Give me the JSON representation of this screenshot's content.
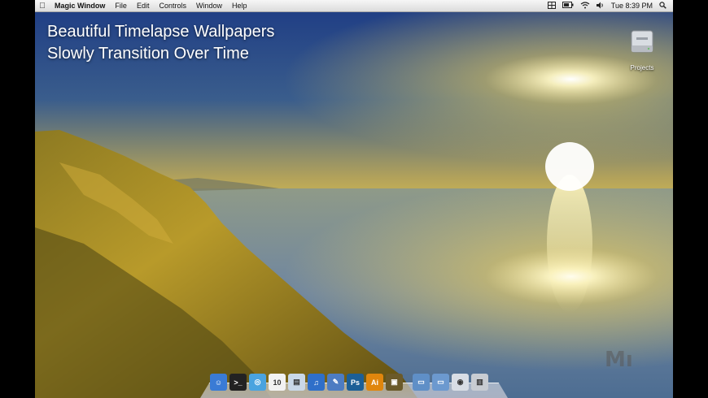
{
  "menubar": {
    "apple_icon": "apple-icon",
    "app_name": "Magic Window",
    "menus": [
      "File",
      "Edit",
      "Controls",
      "Window",
      "Help"
    ],
    "clock": "Tue 8:39 PM",
    "status_icons": [
      "grid-icon",
      "battery-icon",
      "wifi-icon",
      "volume-icon",
      "spotlight-icon"
    ]
  },
  "caption": {
    "line1": "Beautiful Timelapse Wallpapers",
    "line2": "Slowly Transition Over Time"
  },
  "desktop": {
    "icon_label": "Projects"
  },
  "dock": {
    "apps": [
      {
        "name": "finder-icon",
        "color": "#3a7bd5",
        "glyph": "☺"
      },
      {
        "name": "terminal-icon",
        "color": "#222222",
        "glyph": ">_"
      },
      {
        "name": "safari-icon",
        "color": "#4aa3df",
        "glyph": "◎"
      },
      {
        "name": "calendar-icon",
        "color": "#f2f2f2",
        "glyph": "10"
      },
      {
        "name": "preview-icon",
        "color": "#c9d8e8",
        "glyph": "▤"
      },
      {
        "name": "itunes-icon",
        "color": "#2f6fc9",
        "glyph": "♫"
      },
      {
        "name": "xcode-icon",
        "color": "#4d7cc2",
        "glyph": "✎"
      },
      {
        "name": "photoshop-icon",
        "color": "#1c5f97",
        "glyph": "Ps"
      },
      {
        "name": "illustrator-icon",
        "color": "#e0860d",
        "glyph": "Ai"
      },
      {
        "name": "magic-window-icon",
        "color": "#6b5a2a",
        "glyph": "▣"
      },
      {
        "name": "applications-folder-icon",
        "color": "#5f8fc7",
        "glyph": "▭"
      },
      {
        "name": "documents-folder-icon",
        "color": "#6c99cf",
        "glyph": "▭"
      },
      {
        "name": "downloads-icon",
        "color": "#d8dde5",
        "glyph": "◉"
      },
      {
        "name": "trash-icon",
        "color": "#c8ccd2",
        "glyph": "▥"
      }
    ]
  },
  "colors": {
    "sky_top": "#1f3f86",
    "sun": "#fff3b0",
    "horizon": "#e6c85a"
  },
  "watermark": "Mı"
}
